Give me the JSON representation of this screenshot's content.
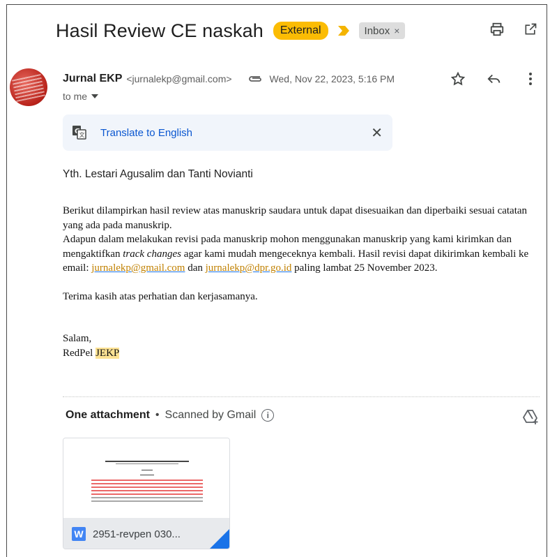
{
  "email": {
    "subject": "Hasil Review CE naskah",
    "labels": {
      "external": "External",
      "inbox": "Inbox",
      "inbox_remove": "×"
    },
    "sender": {
      "name": "Jurnal EKP",
      "email": "<jurnalekp@gmail.com>",
      "date": "Wed, Nov 22, 2023, 5:16 PM",
      "to": "to me"
    },
    "translate": {
      "link": "Translate to English",
      "close": "✕"
    },
    "body": {
      "greeting": "Yth. Lestari Agusalim dan Tanti Novianti",
      "p1": "Berikut dilampirkan hasil review atas manuskrip saudara untuk dapat disesuaikan dan diperbaiki sesuai catatan yang ada pada manuskrip.",
      "p2_a": "Adapun dalam melakukan revisi pada manuskrip mohon menggunakan manuskrip yang kami kirimkan dan mengaktifkan ",
      "p2_em": "track changes",
      "p2_b": " agar kami mudah mengeceknya kembali. Hasil revisi dapat dikirimkan kembali ke email:  ",
      "p2_link1": "jurnalekp@gmail.com",
      "p2_and": " dan  ",
      "p2_link2": "jurnalekp@dpr.go.id",
      "p2_c": "  paling lambat 25 November 2023.",
      "p3": "Terima kasih atas perhatian dan kerjasamanya.",
      "closing": "Salam,",
      "sign_prefix": "RedPel ",
      "sign_hl": "JEKP"
    },
    "attachments": {
      "title": "One attachment",
      "dot": "•",
      "scanned": "Scanned by Gmail",
      "info": "i",
      "file_icon": "W",
      "file_name": "2951-revpen 030..."
    }
  },
  "colors": {
    "external_label": "#fbbc04",
    "link_blue": "#0b57d0",
    "word_blue": "#4285f4",
    "highlight": "#fde293"
  },
  "icons": [
    "print-icon",
    "open-in-new-icon",
    "star-icon",
    "reply-icon",
    "more-vert-icon",
    "paperclip-icon",
    "dropdown-icon",
    "translate-icon",
    "close-icon",
    "info-icon",
    "add-to-drive-icon",
    "word-file-icon"
  ]
}
